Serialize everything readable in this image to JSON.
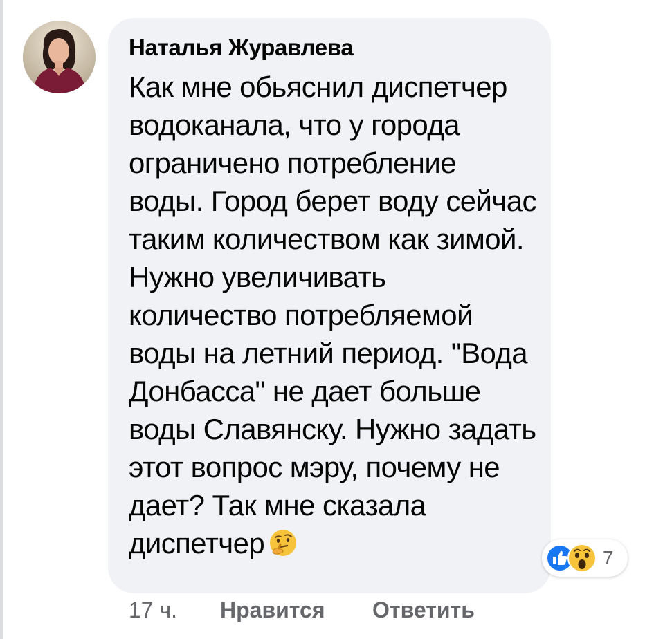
{
  "comment": {
    "author": "Наталья Журавлева",
    "text": "Как мне обьяснил диспетчер водоканала, что у города ограничено потребление воды. Город берет воду сейчас таким количеством как зимой. Нужно увеличивать количество потребляемой воды на летний период. \"Вода Донбасса\" не дает больше воды Славянску. Нужно задать этот вопрос мэру, почему не дает? Так мне сказала диспетчер",
    "trailing_emoji": "thinking-face-icon",
    "timestamp": "17 ч."
  },
  "reactions": {
    "icons": [
      "like-icon",
      "wow-icon"
    ],
    "count": "7"
  },
  "actions": {
    "like_label": "Нравится",
    "reply_label": "Ответить"
  },
  "colors": {
    "bubble": "#f0f2f5",
    "text": "#050505",
    "secondary": "#65676b",
    "like_blue": "#1877f2",
    "wow_yellow": "#f7c33a"
  }
}
